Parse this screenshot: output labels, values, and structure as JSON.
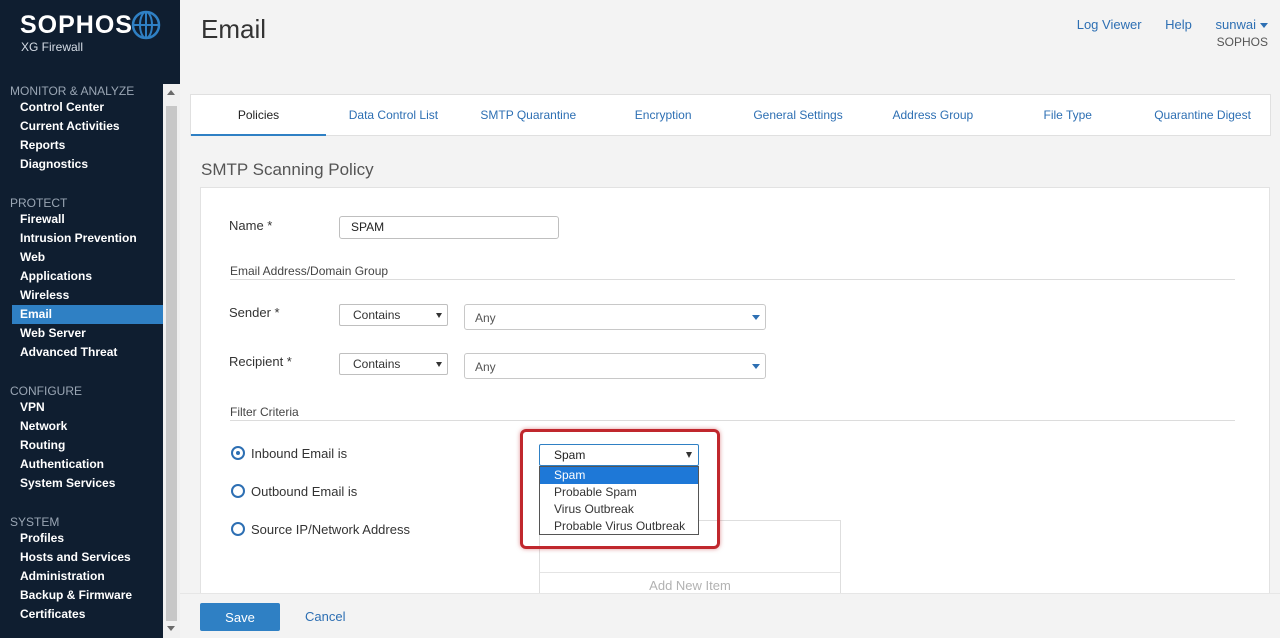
{
  "brand": {
    "name": "SOPHOS",
    "product": "XG Firewall"
  },
  "sidebar": {
    "sections": [
      {
        "title": "MONITOR & ANALYZE",
        "items": [
          "Control Center",
          "Current Activities",
          "Reports",
          "Diagnostics"
        ]
      },
      {
        "title": "PROTECT",
        "items": [
          "Firewall",
          "Intrusion Prevention",
          "Web",
          "Applications",
          "Wireless",
          "Email",
          "Web Server",
          "Advanced Threat"
        ]
      },
      {
        "title": "CONFIGURE",
        "items": [
          "VPN",
          "Network",
          "Routing",
          "Authentication",
          "System Services"
        ]
      },
      {
        "title": "SYSTEM",
        "items": [
          "Profiles",
          "Hosts and Services",
          "Administration",
          "Backup & Firmware",
          "Certificates"
        ]
      }
    ],
    "active_item": "Email"
  },
  "header": {
    "title": "Email",
    "links": {
      "log_viewer": "Log Viewer",
      "help": "Help",
      "user": "sunwai"
    },
    "org": "SOPHOS"
  },
  "tabs": [
    "Policies",
    "Data Control List",
    "SMTP Quarantine",
    "Encryption",
    "General Settings",
    "Address Group",
    "File Type",
    "Quarantine Digest"
  ],
  "active_tab": "Policies",
  "form": {
    "section_title": "SMTP Scanning Policy",
    "name_label": "Name *",
    "name_value": "SPAM",
    "address_group_title": "Email Address/Domain Group",
    "sender_label": "Sender *",
    "sender_operator": "Contains",
    "sender_value": "Any",
    "recipient_label": "Recipient *",
    "recipient_operator": "Contains",
    "recipient_value": "Any",
    "filter_title": "Filter Criteria",
    "radio_inbound": "Inbound Email is",
    "radio_outbound": "Outbound Email is",
    "radio_source": "Source IP/Network Address",
    "inbound_select_value": "Spam",
    "inbound_options": [
      "Spam",
      "Probable Spam",
      "Virus Outbreak",
      "Probable Virus Outbreak"
    ],
    "add_new_item": "Add New Item"
  },
  "footer": {
    "save": "Save",
    "cancel": "Cancel"
  },
  "colors": {
    "sidebar_bg": "#0f1e30",
    "accent": "#2f80c4",
    "link": "#2d6fb3",
    "highlight": "#c0272d"
  }
}
